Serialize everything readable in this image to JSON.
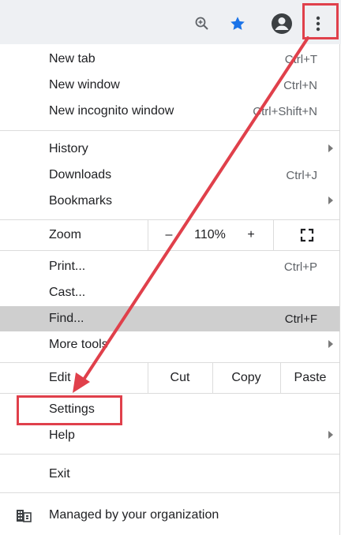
{
  "toolbar": {
    "icons": [
      "zoom-icon",
      "bookmark-star-icon",
      "profile-icon",
      "more-menu-icon"
    ],
    "star_color": "#1a73e8"
  },
  "menu": {
    "new_tab": {
      "label": "New tab",
      "shortcut": "Ctrl+T"
    },
    "new_window": {
      "label": "New window",
      "shortcut": "Ctrl+N"
    },
    "new_incognito": {
      "label": "New incognito window",
      "shortcut": "Ctrl+Shift+N"
    },
    "history": {
      "label": "History"
    },
    "downloads": {
      "label": "Downloads",
      "shortcut": "Ctrl+J"
    },
    "bookmarks": {
      "label": "Bookmarks"
    },
    "zoom": {
      "label": "Zoom",
      "minus": "–",
      "level": "110%",
      "plus": "+"
    },
    "print": {
      "label": "Print...",
      "shortcut": "Ctrl+P"
    },
    "cast": {
      "label": "Cast..."
    },
    "find": {
      "label": "Find...",
      "shortcut": "Ctrl+F"
    },
    "more_tools": {
      "label": "More tools"
    },
    "edit": {
      "label": "Edit",
      "cut": "Cut",
      "copy": "Copy",
      "paste": "Paste"
    },
    "settings": {
      "label": "Settings"
    },
    "help": {
      "label": "Help"
    },
    "exit": {
      "label": "Exit"
    },
    "managed": {
      "label": "Managed by your organization"
    }
  },
  "annotation_color": "#e0404b"
}
